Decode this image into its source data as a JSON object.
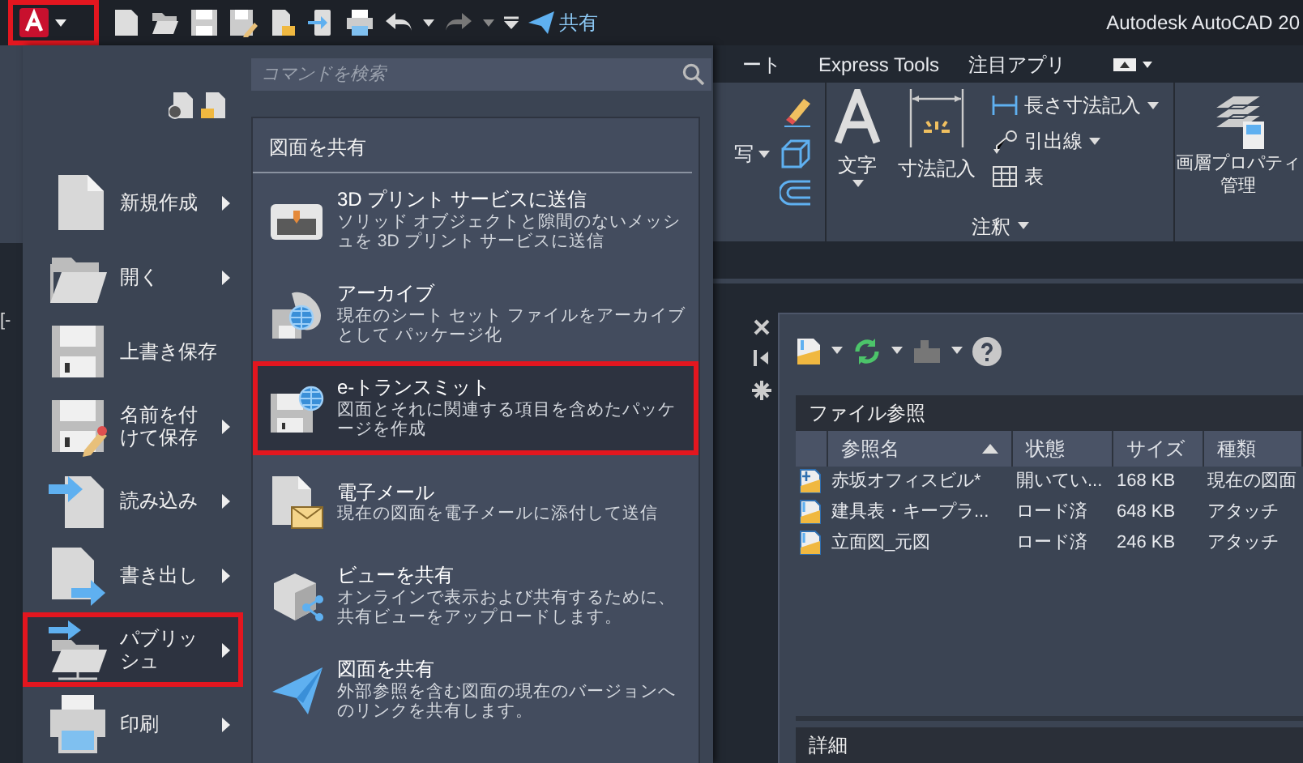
{
  "app_button": {
    "highlighted": true
  },
  "quick_access": {
    "share_label": "共有"
  },
  "window": {
    "title": "Autodesk AutoCAD 20"
  },
  "viewport_label": "[-",
  "app_menu": {
    "search": {
      "placeholder": "コマンドを検索"
    },
    "items": [
      {
        "label": "新規作成",
        "kind": "new",
        "submenu": true,
        "selected": false
      },
      {
        "label": "開く",
        "kind": "open",
        "submenu": true,
        "selected": false
      },
      {
        "label": "上書き保存",
        "kind": "save",
        "submenu": false,
        "selected": false
      },
      {
        "label": "名前を付けて保存",
        "kind": "saveas",
        "submenu": true,
        "selected": false
      },
      {
        "label": "読み込み",
        "kind": "import",
        "submenu": true,
        "selected": false
      },
      {
        "label": "書き出し",
        "kind": "export",
        "submenu": true,
        "selected": false
      },
      {
        "label": "パブリッシュ",
        "kind": "publish",
        "submenu": true,
        "selected": true
      },
      {
        "label": "印刷",
        "kind": "print",
        "submenu": true,
        "selected": false
      }
    ],
    "panel": {
      "title": "図面を共有",
      "items": [
        {
          "title": "3D プリント サービスに送信",
          "description": "ソリッド オブジェクトと隙間のないメッシュを 3D プリント サービスに送信",
          "kind": "print3d",
          "selected": false
        },
        {
          "title": "アーカイブ",
          "description": "現在のシート セット ファイルをアーカイブとして パッケージ化",
          "kind": "archive",
          "selected": false
        },
        {
          "title": "e-トランスミット",
          "description": "図面とそれに関連する項目を含めたパッケージを作成",
          "kind": "etransmit",
          "selected": true
        },
        {
          "title": "電子メール",
          "description": "現在の図面を電子メールに添付して送信",
          "kind": "email",
          "selected": false
        },
        {
          "title": "ビューを共有",
          "description": "オンラインで表示および共有するために、共有ビューをアップロードします。",
          "kind": "shareview",
          "selected": false
        },
        {
          "title": "図面を共有",
          "description": "外部参照を含む図面の現在のバージョンへのリンクを共有します。",
          "kind": "sharedrawing",
          "selected": false
        }
      ]
    }
  },
  "ribbon": {
    "tabs": [
      {
        "label": "ート"
      },
      {
        "label": "Express Tools"
      },
      {
        "label": "注目アプリ"
      }
    ],
    "partial_label": "写",
    "annotation": {
      "title": "注釈",
      "text_tool": "文字",
      "dimension_tool": "寸法記入",
      "small_tools": [
        {
          "label": "長さ寸法記入",
          "kind": "linear",
          "dropdown": true
        },
        {
          "label": "引出線",
          "kind": "leader",
          "dropdown": true
        },
        {
          "label": "表",
          "kind": "table",
          "dropdown": false
        }
      ]
    },
    "layer_tool": "画層プロパティ管理"
  },
  "xref_palette": {
    "section_title": "ファイル参照",
    "columns": [
      "参照名",
      "状態",
      "サイズ",
      "種類"
    ],
    "rows": [
      {
        "name": "赤坂オフィスビル*",
        "status": "開いてい...",
        "size": "168 KB",
        "type": "現在の図面",
        "kind": "current"
      },
      {
        "name": "建具表・キープラ...",
        "status": "ロード済",
        "size": "648 KB",
        "type": "アタッチ",
        "kind": "attach"
      },
      {
        "name": "立面図_元図",
        "status": "ロード済",
        "size": "246 KB",
        "type": "アタッチ",
        "kind": "attach"
      }
    ],
    "details_title": "詳細"
  }
}
